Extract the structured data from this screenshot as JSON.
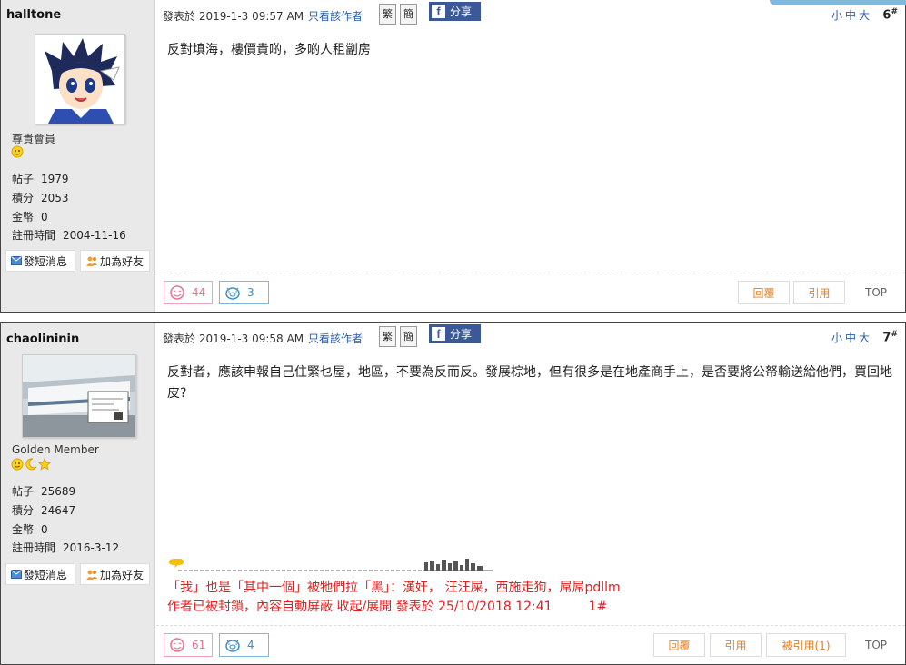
{
  "posts": [
    {
      "username": "halltone",
      "rank": "尊貴會員",
      "stats": [
        {
          "label": "帖子",
          "value": "1979"
        },
        {
          "label": "積分",
          "value": "2053"
        },
        {
          "label": "金幣",
          "value": "0"
        },
        {
          "label": "註冊時間",
          "value": "2004-11-16"
        }
      ],
      "pm_label": "發短消息",
      "friend_label": "加為好友",
      "posted_at": "發表於 2019-1-3 09:57 AM",
      "only_author": "只看該作者",
      "trad": "繁",
      "simp": "簡",
      "share": "分享",
      "font_size": "小中大",
      "floor": "6",
      "floor_mark": "#",
      "content": "反對填海，樓價貴啲，多啲人租劏房",
      "likes": "44",
      "dislikes": "3",
      "reply": "回覆",
      "quote": "引用",
      "top": "TOP"
    },
    {
      "username": "chaolininin",
      "rank": "Golden Member",
      "stats": [
        {
          "label": "帖子",
          "value": "25689"
        },
        {
          "label": "積分",
          "value": "24647"
        },
        {
          "label": "金幣",
          "value": "0"
        },
        {
          "label": "註冊時間",
          "value": "2016-3-12"
        }
      ],
      "pm_label": "發短消息",
      "friend_label": "加為好友",
      "posted_at": "發表於 2019-1-3 09:58 AM",
      "only_author": "只看該作者",
      "trad": "繁",
      "simp": "簡",
      "share": "分享",
      "font_size": "小中大",
      "floor": "7",
      "floor_mark": "#",
      "content": "反對者，應該申報自己住緊乜屋，地區，不要為反而反。發展棕地，但有很多是在地產商手上，是否要將公帑輸送給他們，買回地皮?",
      "signature_line1": "「我」也是「其中一個」被牠們拉「黑」：漢奸， 汪汪屎，西施走狗，屌屌pdllm",
      "signature_line2": "作者已被封鎖，內容自動屏蔽 收起/展開 發表於 25/10/2018 12:41         1#",
      "likes": "61",
      "dislikes": "4",
      "reply": "回覆",
      "quote": "引用",
      "quoted_by": "被引用(1)",
      "top": "TOP"
    }
  ],
  "colors": {
    "link": "#2a5caa",
    "action": "#e67e22",
    "signature": "#e02020",
    "facebook": "#3b5998"
  }
}
